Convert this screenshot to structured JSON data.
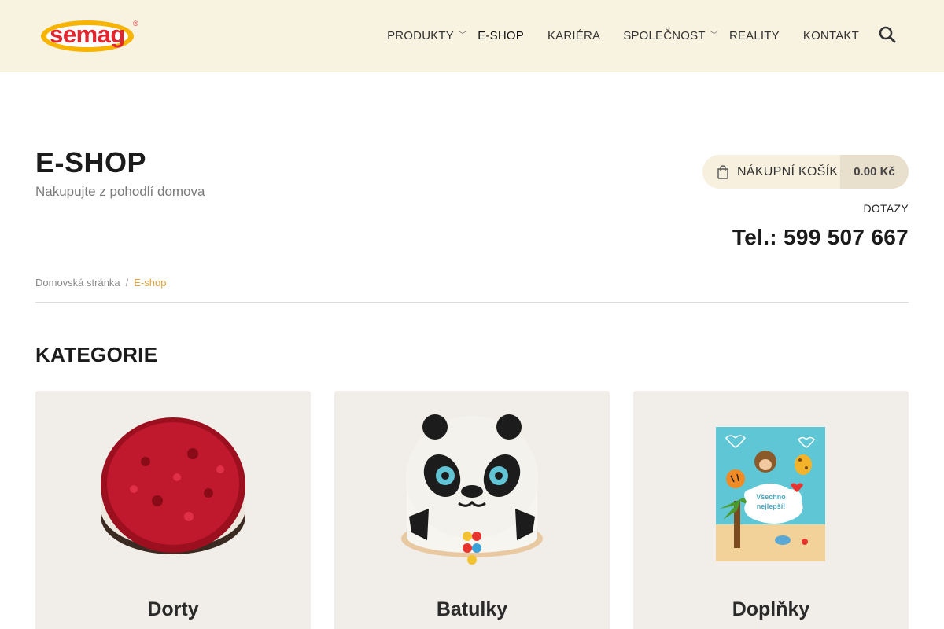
{
  "brand": {
    "logo_text": "semag"
  },
  "nav": {
    "items": [
      {
        "label": "PRODUKTY",
        "has_dropdown": true
      },
      {
        "label": "E-SHOP",
        "has_dropdown": false,
        "active": true
      },
      {
        "label": "KARIÉRA",
        "has_dropdown": false
      },
      {
        "label": "SPOLEČNOST",
        "has_dropdown": true
      },
      {
        "label": "REALITY",
        "has_dropdown": false
      },
      {
        "label": "KONTAKT",
        "has_dropdown": false
      }
    ],
    "search_icon": "search-icon"
  },
  "page": {
    "title": "E-SHOP",
    "subtitle": "Nakupujte z pohodlí domova"
  },
  "cart": {
    "label": "NÁKUPNÍ KOŠÍK",
    "total": "0.00 Kč",
    "icon": "shopping-bag-icon"
  },
  "faq_label": "DOTAZY",
  "phone": "Tel.: 599 507 667",
  "breadcrumb": {
    "home": "Domovská stránka",
    "separator": "/",
    "current": "E-shop"
  },
  "categories": {
    "title": "KATEGORIE",
    "items": [
      {
        "label": "Dorty",
        "image": "red-fruit-cheesecake"
      },
      {
        "label": "Batulky",
        "image": "panda-cake"
      },
      {
        "label": "Doplňky",
        "image": "jungle-animals-card"
      }
    ]
  },
  "colors": {
    "header_bg": "#f8f2e0",
    "accent": "#e3a33a",
    "card_bg": "#f1ede8",
    "logo_red": "#e3262e",
    "logo_yellow": "#f7b400"
  }
}
